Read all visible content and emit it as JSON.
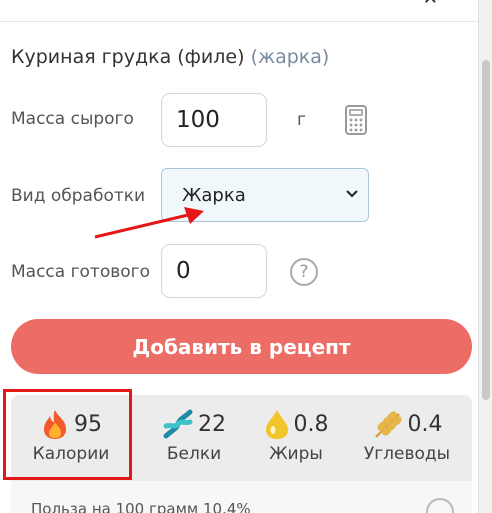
{
  "header": {
    "close_glyph": "✕"
  },
  "product": {
    "name": "Куриная грудка (филе)",
    "method_tag": "(жарка)"
  },
  "form": {
    "raw_mass_label": "Масса сырого",
    "raw_mass_value": "100",
    "raw_mass_unit": "г",
    "processing_label": "Вид обработки",
    "processing_value": "Жарка",
    "cooked_mass_label": "Масса готового",
    "cooked_mass_value": "0",
    "help_glyph": "?"
  },
  "add_button": {
    "label": "Добавить в рецепт"
  },
  "nutrition": [
    {
      "icon": "fire-icon",
      "value": "95",
      "label": "Калории"
    },
    {
      "icon": "dna-icon",
      "value": "22",
      "label": "Белки"
    },
    {
      "icon": "oil-drop-icon",
      "value": "0.8",
      "label": "Жиры"
    },
    {
      "icon": "wheat-icon",
      "value": "0.4",
      "label": "Углеводы"
    }
  ],
  "footer_fragment": "Польза на 100 грамм 10.4%",
  "colors": {
    "accent": "#ec6c66",
    "annotation": "#e31818"
  }
}
